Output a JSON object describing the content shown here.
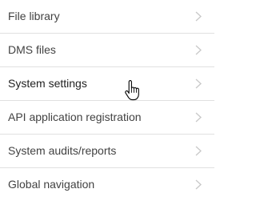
{
  "menu": {
    "items": [
      {
        "label": "File library"
      },
      {
        "label": "DMS files"
      },
      {
        "label": "System settings"
      },
      {
        "label": "API application registration"
      },
      {
        "label": "System audits/reports"
      },
      {
        "label": "Global navigation"
      }
    ]
  },
  "colors": {
    "text": "#424242",
    "divider": "#e0e0e0",
    "chevron": "#c8c8c8"
  },
  "icons": {
    "chevron": "chevron-right-icon",
    "cursor": "hand-pointer-cursor-icon"
  }
}
